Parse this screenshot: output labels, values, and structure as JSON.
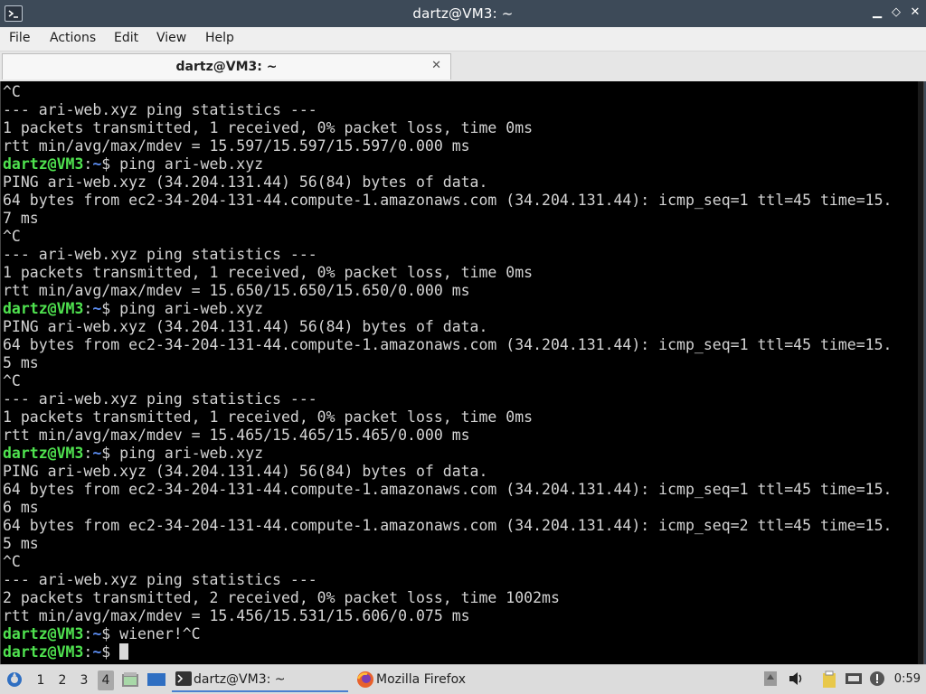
{
  "window": {
    "title": "dartz@VM3: ~",
    "controls": {
      "minimize": "▁",
      "maximize": "◇",
      "close": "✕"
    }
  },
  "menu": [
    "File",
    "Actions",
    "Edit",
    "View",
    "Help"
  ],
  "tab": {
    "label": "dartz@VM3: ~",
    "close": "✕"
  },
  "terminal": {
    "lines": [
      {
        "t": "^C"
      },
      {
        "t": "--- ari-web.xyz ping statistics ---"
      },
      {
        "t": "1 packets transmitted, 1 received, 0% packet loss, time 0ms"
      },
      {
        "t": "rtt min/avg/max/mdev = 15.597/15.597/15.597/0.000 ms"
      },
      {
        "user": "dartz@VM3",
        "path": "~",
        "cmd": "ping ari-web.xyz"
      },
      {
        "t": "PING ari-web.xyz (34.204.131.44) 56(84) bytes of data."
      },
      {
        "t": "64 bytes from ec2-34-204-131-44.compute-1.amazonaws.com (34.204.131.44): icmp_seq=1 ttl=45 time=15."
      },
      {
        "t": "7 ms"
      },
      {
        "t": "^C"
      },
      {
        "t": "--- ari-web.xyz ping statistics ---"
      },
      {
        "t": "1 packets transmitted, 1 received, 0% packet loss, time 0ms"
      },
      {
        "t": "rtt min/avg/max/mdev = 15.650/15.650/15.650/0.000 ms"
      },
      {
        "user": "dartz@VM3",
        "path": "~",
        "cmd": "ping ari-web.xyz"
      },
      {
        "t": "PING ari-web.xyz (34.204.131.44) 56(84) bytes of data."
      },
      {
        "t": "64 bytes from ec2-34-204-131-44.compute-1.amazonaws.com (34.204.131.44): icmp_seq=1 ttl=45 time=15."
      },
      {
        "t": "5 ms"
      },
      {
        "t": "^C"
      },
      {
        "t": "--- ari-web.xyz ping statistics ---"
      },
      {
        "t": "1 packets transmitted, 1 received, 0% packet loss, time 0ms"
      },
      {
        "t": "rtt min/avg/max/mdev = 15.465/15.465/15.465/0.000 ms"
      },
      {
        "user": "dartz@VM3",
        "path": "~",
        "cmd": "ping ari-web.xyz"
      },
      {
        "t": "PING ari-web.xyz (34.204.131.44) 56(84) bytes of data."
      },
      {
        "t": "64 bytes from ec2-34-204-131-44.compute-1.amazonaws.com (34.204.131.44): icmp_seq=1 ttl=45 time=15."
      },
      {
        "t": "6 ms"
      },
      {
        "t": "64 bytes from ec2-34-204-131-44.compute-1.amazonaws.com (34.204.131.44): icmp_seq=2 ttl=45 time=15."
      },
      {
        "t": "5 ms"
      },
      {
        "t": "^C"
      },
      {
        "t": "--- ari-web.xyz ping statistics ---"
      },
      {
        "t": "2 packets transmitted, 2 received, 0% packet loss, time 1002ms"
      },
      {
        "t": "rtt min/avg/max/mdev = 15.456/15.531/15.606/0.075 ms"
      },
      {
        "user": "dartz@VM3",
        "path": "~",
        "cmd": "wiener!^C"
      },
      {
        "user": "dartz@VM3",
        "path": "~",
        "cmd": "",
        "cursor": true
      }
    ]
  },
  "taskbar": {
    "workspaces": [
      "1",
      "2",
      "3",
      "4"
    ],
    "active_workspace": "4",
    "tasks": [
      {
        "label": "dartz@VM3: ~",
        "icon": "terminal-icon",
        "active": true
      },
      {
        "label": "Mozilla Firefox",
        "icon": "firefox-icon",
        "active": false
      }
    ],
    "clock": "0:59"
  },
  "colors": {
    "prompt_user": "#4fe24f",
    "prompt_path": "#5b8cf0",
    "terminal_bg": "#000000",
    "terminal_fg": "#d4d4d4",
    "titlebar_bg": "#3d4a58"
  }
}
